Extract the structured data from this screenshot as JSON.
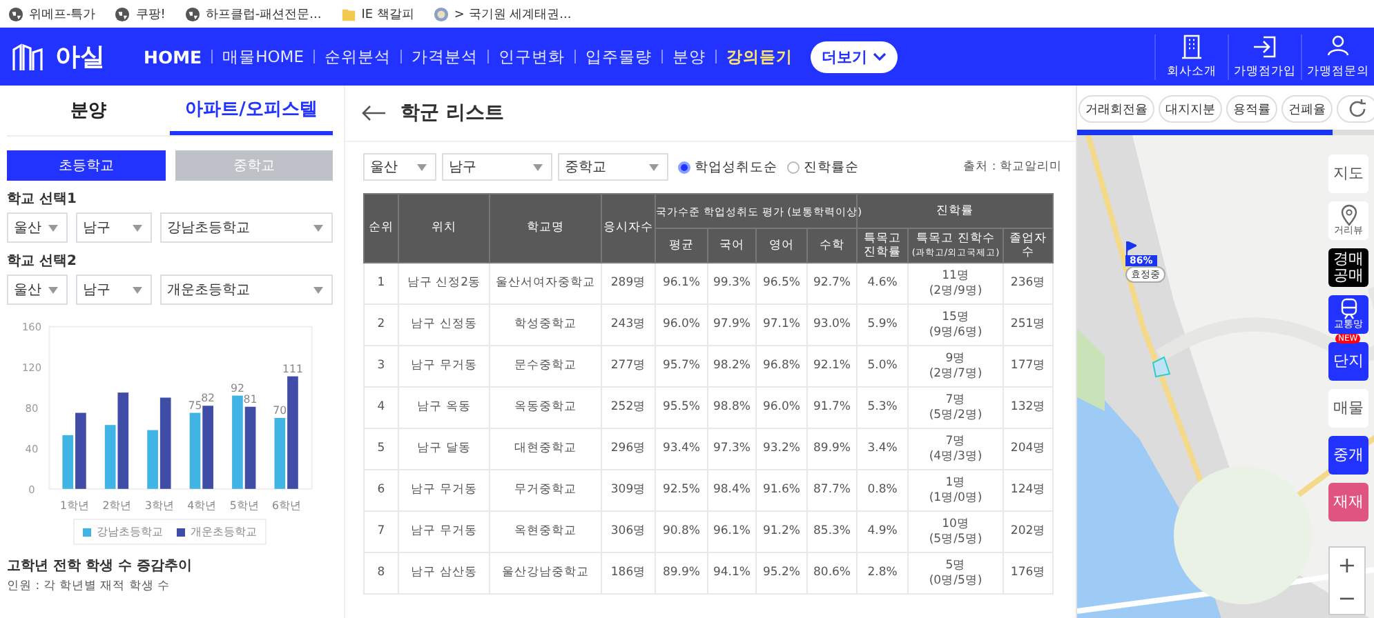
{
  "bookmarks": [
    {
      "label": "위메프-특가",
      "kind": "globe"
    },
    {
      "label": "쿠팡!",
      "kind": "globe"
    },
    {
      "label": "하프클럽-패션전문...",
      "kind": "globe"
    },
    {
      "label": "IE 책갈피",
      "kind": "folder"
    },
    {
      "label": "> 국기원 세계태권...",
      "kind": "emblem"
    }
  ],
  "nav": {
    "logo": "아실",
    "items": [
      {
        "label": "HOME",
        "selected": true,
        "kind": "plain"
      },
      {
        "label": "매물HOME",
        "selected": false,
        "kind": "plain"
      },
      {
        "label": "순위분석",
        "selected": false,
        "kind": "plain"
      },
      {
        "label": "가격분석",
        "selected": false,
        "kind": "plain"
      },
      {
        "label": "인구변화",
        "selected": false,
        "kind": "plain"
      },
      {
        "label": "입주물량",
        "selected": false,
        "kind": "plain"
      },
      {
        "label": "분양",
        "selected": false,
        "kind": "plain"
      },
      {
        "label": "강의듣기",
        "selected": false,
        "kind": "highlight"
      }
    ],
    "more": "더보기",
    "actions": [
      {
        "label": "회사소개",
        "kind": "building"
      },
      {
        "label": "가맹점가입",
        "kind": "enter"
      },
      {
        "label": "가맹점문의",
        "kind": "person"
      }
    ]
  },
  "left": {
    "tabs": [
      {
        "label": "분양",
        "selected": false
      },
      {
        "label": "아파트/오피스텔",
        "selected": true
      }
    ],
    "levels": [
      {
        "label": "초등학교",
        "selected": true
      },
      {
        "label": "중학교",
        "selected": false
      }
    ],
    "pickers": [
      {
        "label": "학교 선택1",
        "selects": [
          "울산",
          "남구",
          "강남초등학교"
        ]
      },
      {
        "label": "학교 선택2",
        "selects": [
          "울산",
          "남구",
          "개운초등학교"
        ]
      }
    ],
    "chart_data": {
      "type": "bar",
      "categories": [
        "1학년",
        "2학년",
        "3학년",
        "4학년",
        "5학년",
        "6학년"
      ],
      "series": [
        {
          "name": "강남초등학교",
          "color": "#41b4e6",
          "values": [
            53,
            63,
            58,
            75,
            92,
            70
          ]
        },
        {
          "name": "개운초등학교",
          "color": "#3f4da6",
          "values": [
            75,
            95,
            90,
            82,
            81,
            111
          ]
        }
      ],
      "ylim": [
        0,
        160
      ],
      "yticks": [
        0,
        40,
        80,
        120,
        160
      ],
      "value_labels": [
        [
          null,
          null,
          null,
          "75",
          "92",
          "70"
        ],
        [
          null,
          null,
          null,
          "82",
          "81",
          "111"
        ]
      ]
    },
    "title": "고학년 전학 학생 수 증감추이",
    "note": "인원 : 각 학년별 재적 학생 수"
  },
  "list": {
    "title": "학군 리스트",
    "filters": [
      "울산",
      "남구",
      "중학교"
    ],
    "sorts": [
      {
        "label": "학업성취도순",
        "selected": true
      },
      {
        "label": "진학률순",
        "selected": false
      }
    ],
    "source": "출처 : 학교알리미",
    "table": {
      "columns": [
        "순위",
        "위치",
        "학교명",
        "응시자수"
      ],
      "group_1": "국가수준 학업성취도 평가 (보통학력이상)",
      "group_1_columns": [
        "평균",
        "국어",
        "영어",
        "수학"
      ],
      "group_2": "진학률",
      "group_2_columns": [
        {
          "label": "특목고\n진학률"
        },
        {
          "label": "특목고 진학수",
          "sub": "(과학고/외고국제고)"
        },
        {
          "label": "졸업자\n수"
        }
      ],
      "rows": [
        [
          "1",
          "남구 신정2동",
          "울산서여자중학교",
          "289명",
          "96.1%",
          "99.3%",
          "96.5%",
          "92.7%",
          "4.6%",
          "11명\n(2명/9명)",
          "236명"
        ],
        [
          "2",
          "남구 신정동",
          "학성중학교",
          "243명",
          "96.0%",
          "97.9%",
          "97.1%",
          "93.0%",
          "5.9%",
          "15명\n(9명/6명)",
          "251명"
        ],
        [
          "3",
          "남구 무거동",
          "문수중학교",
          "277명",
          "95.7%",
          "98.2%",
          "96.8%",
          "92.1%",
          "5.0%",
          "9명\n(2명/7명)",
          "177명"
        ],
        [
          "4",
          "남구 옥동",
          "옥동중학교",
          "252명",
          "95.5%",
          "98.8%",
          "96.0%",
          "91.7%",
          "5.3%",
          "7명\n(5명/2명)",
          "132명"
        ],
        [
          "5",
          "남구 달동",
          "대현중학교",
          "296명",
          "93.4%",
          "97.3%",
          "93.2%",
          "89.9%",
          "3.4%",
          "7명\n(4명/3명)",
          "204명"
        ],
        [
          "6",
          "남구 무거동",
          "무거중학교",
          "309명",
          "92.5%",
          "98.4%",
          "91.6%",
          "87.7%",
          "0.8%",
          "1명\n(1명/0명)",
          "124명"
        ],
        [
          "7",
          "남구 무거동",
          "옥현중학교",
          "306명",
          "90.8%",
          "96.1%",
          "91.2%",
          "85.3%",
          "4.9%",
          "10명\n(5명/5명)",
          "202명"
        ],
        [
          "8",
          "남구 삼산동",
          "울산강남중학교",
          "186명",
          "89.9%",
          "94.1%",
          "95.2%",
          "80.6%",
          "2.8%",
          "5명\n(0명/5명)",
          "176명"
        ]
      ]
    }
  },
  "map": {
    "chips": [
      "거래회전율",
      "대지지분",
      "용적률",
      "건폐율"
    ],
    "progress": {
      "level": 0.86
    },
    "marker": {
      "percent": "86%",
      "label": "효정중"
    },
    "side": [
      {
        "label": "지도",
        "kind": "light"
      },
      {
        "label": "거리뷰",
        "kind": "pin"
      },
      {
        "label": "경매\n공매",
        "kind": "dark"
      },
      {
        "label": "교통망",
        "kind": "train"
      },
      {
        "label": "단지",
        "kind": "blue",
        "badge": "NEW"
      },
      {
        "label": "매물",
        "kind": "light"
      },
      {
        "label": "중개",
        "kind": "blue"
      },
      {
        "label": "재재",
        "kind": "pink"
      }
    ],
    "zoom": [
      "+",
      "−"
    ]
  }
}
